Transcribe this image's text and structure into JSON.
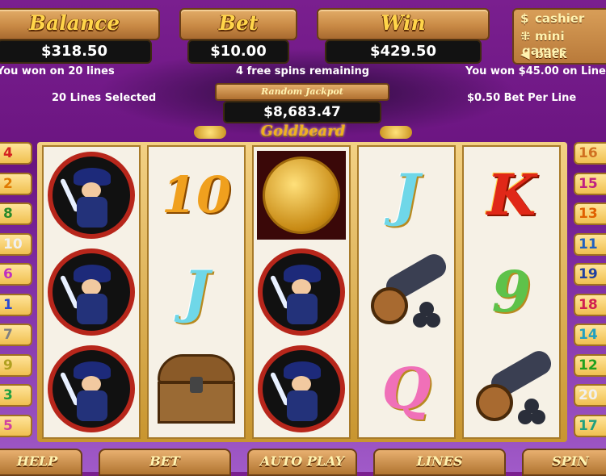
{
  "header": {
    "balance": {
      "label": "Balance",
      "value": "$318.50"
    },
    "bet": {
      "label": "Bet",
      "value": "$10.00"
    },
    "win": {
      "label": "Win",
      "value": "$429.50"
    }
  },
  "menu": {
    "cashier": "cashier",
    "mini_games": "mini games",
    "back": "back"
  },
  "info": {
    "left_win": "You won on 20 lines",
    "free_spins": "4 free spins remaining",
    "right_win": "You won $45.00 on Lines",
    "lines_selected": "20 Lines Selected",
    "bet_per_line": "$0.50 Bet Per Line"
  },
  "jackpot": {
    "label": "Random Jackpot",
    "value": "$8,683.47"
  },
  "logo": "Goldbeard",
  "reels": [
    [
      "pirate",
      "pirate",
      "pirate"
    ],
    [
      "10",
      "J",
      "chest"
    ],
    [
      "coin",
      "pirate",
      "pirate"
    ],
    [
      "J",
      "cannon",
      "Q"
    ],
    [
      "K",
      "9",
      "cannon"
    ]
  ],
  "line_pads_left": [
    {
      "n": "4",
      "color": "#d42020"
    },
    {
      "n": "2",
      "color": "#e07a00"
    },
    {
      "n": "8",
      "color": "#2a8a2a"
    },
    {
      "n": "10",
      "color": "#f0f0f0"
    },
    {
      "n": "6",
      "color": "#c030c0"
    },
    {
      "n": "1",
      "color": "#2a4ad0"
    },
    {
      "n": "7",
      "color": "#808080"
    },
    {
      "n": "9",
      "color": "#b0a020"
    },
    {
      "n": "3",
      "color": "#20a040"
    },
    {
      "n": "5",
      "color": "#d040a0"
    }
  ],
  "line_pads_right": [
    {
      "n": "16",
      "color": "#d07020"
    },
    {
      "n": "15",
      "color": "#c02080"
    },
    {
      "n": "13",
      "color": "#e06000"
    },
    {
      "n": "11",
      "color": "#2060c0"
    },
    {
      "n": "19",
      "color": "#2040a0"
    },
    {
      "n": "18",
      "color": "#d02050"
    },
    {
      "n": "14",
      "color": "#20a0c0"
    },
    {
      "n": "12",
      "color": "#20a020"
    },
    {
      "n": "20",
      "color": "#f0f0f0"
    },
    {
      "n": "17",
      "color": "#20a080"
    }
  ],
  "buttons": {
    "help": "HELP",
    "bet": "BET",
    "autoplay": "AUTO PLAY",
    "lines": "LINES",
    "spin": "SPIN"
  }
}
